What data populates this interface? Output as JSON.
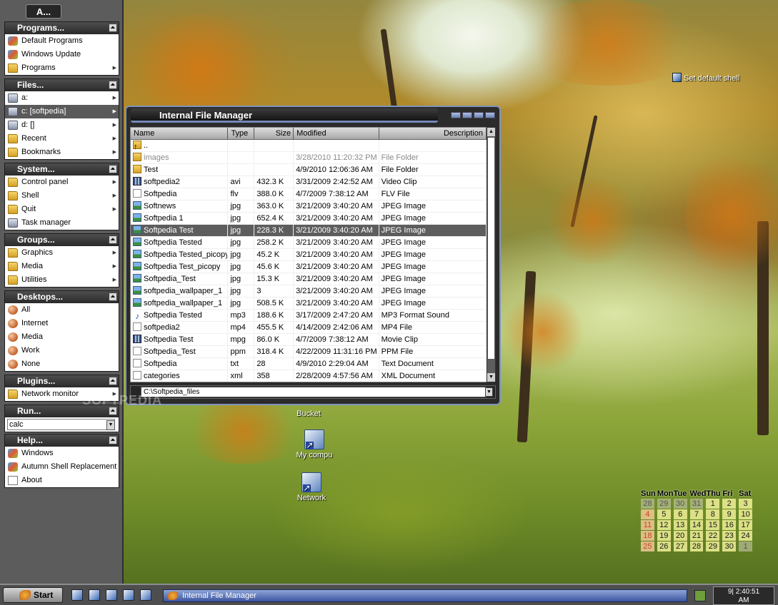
{
  "panel": {
    "title": "A...",
    "sections": [
      {
        "header": "Programs...",
        "items": [
          {
            "label": "Default Programs",
            "icon": "default-programs-icon"
          },
          {
            "label": "Windows Update",
            "icon": "windows-update-icon"
          },
          {
            "label": "Programs",
            "icon": "folder-icon",
            "submenu": true
          }
        ]
      },
      {
        "header": "Files...",
        "items": [
          {
            "label": "a:",
            "icon": "floppy-drive-icon",
            "submenu": true
          },
          {
            "label": "c: [softpedia]",
            "icon": "hard-drive-icon",
            "submenu": true,
            "selected": true
          },
          {
            "label": "d: []",
            "icon": "cd-drive-icon",
            "submenu": true
          },
          {
            "label": "Recent",
            "icon": "folder-icon",
            "submenu": true
          },
          {
            "label": "Bookmarks",
            "icon": "folder-icon",
            "submenu": true
          }
        ]
      },
      {
        "header": "System...",
        "items": [
          {
            "label": "Control panel",
            "icon": "control-panel-icon",
            "submenu": true
          },
          {
            "label": "Shell",
            "icon": "folder-icon",
            "submenu": true
          },
          {
            "label": "Quit",
            "icon": "folder-icon",
            "submenu": true
          },
          {
            "label": "Task manager",
            "icon": "task-manager-icon"
          }
        ]
      },
      {
        "header": "Groups...",
        "items": [
          {
            "label": "Graphics",
            "icon": "folder-icon",
            "submenu": true
          },
          {
            "label": "Media",
            "icon": "folder-icon",
            "submenu": true
          },
          {
            "label": "Utilities",
            "icon": "folder-icon",
            "submenu": true
          }
        ]
      },
      {
        "header": "Desktops...",
        "items": [
          {
            "label": "All",
            "icon": "desktop-globe-icon"
          },
          {
            "label": "Internet",
            "icon": "desktop-globe-icon"
          },
          {
            "label": "Media",
            "icon": "desktop-globe-icon"
          },
          {
            "label": "Work",
            "icon": "desktop-globe-icon"
          },
          {
            "label": "None",
            "icon": "desktop-globe-icon"
          }
        ]
      },
      {
        "header": "Plugins...",
        "items": [
          {
            "label": "Network monitor",
            "icon": "folder-icon",
            "submenu": true
          }
        ]
      },
      {
        "header": "Run...",
        "items": []
      },
      {
        "header": "Help...",
        "items": [
          {
            "label": "Windows",
            "icon": "windows-help-icon"
          },
          {
            "label": "Autumn Shell Replacement",
            "icon": "help-book-icon"
          },
          {
            "label": "About",
            "icon": "about-icon"
          }
        ]
      }
    ],
    "run_value": "calc"
  },
  "file_manager": {
    "title": "Internal File Manager",
    "columns": [
      "Name",
      "Type",
      "Size",
      "Modified",
      "Description"
    ],
    "rows": [
      {
        "name": "..",
        "type": "",
        "size": "",
        "modified": "",
        "description": "",
        "icon": "up-folder"
      },
      {
        "name": "images",
        "type": "",
        "size": "",
        "modified": "3/28/2010 11:20:32 PM",
        "description": "File Folder",
        "icon": "folder",
        "dim": true
      },
      {
        "name": "Test",
        "type": "",
        "size": "",
        "modified": "4/9/2010 12:06:36 AM",
        "description": "File Folder",
        "icon": "folder"
      },
      {
        "name": "softpedia2",
        "type": "avi",
        "size": "432.3 K",
        "modified": "3/31/2009 2:42:52 AM",
        "description": "Video Clip",
        "icon": "video"
      },
      {
        "name": "Softpedia",
        "type": "flv",
        "size": "388.0 K",
        "modified": "4/7/2009 7:38:12 AM",
        "description": "FLV File",
        "icon": "file"
      },
      {
        "name": "Softnews",
        "type": "jpg",
        "size": "363.0 K",
        "modified": "3/21/2009 3:40:20 AM",
        "description": "JPEG Image",
        "icon": "image"
      },
      {
        "name": "Softpedia 1",
        "type": "jpg",
        "size": "652.4 K",
        "modified": "3/21/2009 3:40:20 AM",
        "description": "JPEG Image",
        "icon": "image"
      },
      {
        "name": "Softpedia Test",
        "type": "jpg",
        "size": "228.3 K",
        "modified": "3/21/2009 3:40:20 AM",
        "description": "JPEG Image",
        "icon": "image",
        "selected": true
      },
      {
        "name": "Softpedia Tested",
        "type": "jpg",
        "size": "258.2 K",
        "modified": "3/21/2009 3:40:20 AM",
        "description": "JPEG Image",
        "icon": "image"
      },
      {
        "name": "Softpedia Tested_picopy",
        "type": "jpg",
        "size": "45.2 K",
        "modified": "3/21/2009 3:40:20 AM",
        "description": "JPEG Image",
        "icon": "image"
      },
      {
        "name": "Softpedia Test_picopy",
        "type": "jpg",
        "size": "45.6 K",
        "modified": "3/21/2009 3:40:20 AM",
        "description": "JPEG Image",
        "icon": "image"
      },
      {
        "name": "Softpedia_Test",
        "type": "jpg",
        "size": "15.3 K",
        "modified": "3/21/2009 3:40:20 AM",
        "description": "JPEG Image",
        "icon": "image"
      },
      {
        "name": "softpedia_wallpaper_1",
        "type": "jpg",
        "size": "3",
        "modified": "3/21/2009 3:40:20 AM",
        "description": "JPEG Image",
        "icon": "image"
      },
      {
        "name": "softpedia_wallpaper_1",
        "type": "jpg",
        "size": "508.5 K",
        "modified": "3/21/2009 3:40:20 AM",
        "description": "JPEG Image",
        "icon": "image"
      },
      {
        "name": "Softpedia Tested",
        "type": "mp3",
        "size": "188.6 K",
        "modified": "3/17/2009 2:47:20 AM",
        "description": "MP3 Format Sound",
        "icon": "music"
      },
      {
        "name": "softpedia2",
        "type": "mp4",
        "size": "455.5 K",
        "modified": "4/14/2009 2:42:06 AM",
        "description": "MP4 File",
        "icon": "file"
      },
      {
        "name": "Softpedia Test",
        "type": "mpg",
        "size": "86.0 K",
        "modified": "4/7/2009 7:38:12 AM",
        "description": "Movie Clip",
        "icon": "video"
      },
      {
        "name": "Softpedia_Test",
        "type": "ppm",
        "size": "318.4 K",
        "modified": "4/22/2009 11:31:16 PM",
        "description": "PPM File",
        "icon": "file"
      },
      {
        "name": "Softpedia",
        "type": "txt",
        "size": "28",
        "modified": "4/9/2010 2:29:04 AM",
        "description": "Text Document",
        "icon": "file"
      },
      {
        "name": "categories",
        "type": "xml",
        "size": "358",
        "modified": "2/28/2009 4:57:56 AM",
        "description": "XML Document",
        "icon": "file"
      }
    ],
    "path": "C:\\Softpedia_files"
  },
  "desktop_icons": [
    {
      "label": "Bucket",
      "name": "recycle-bin-shortcut"
    },
    {
      "label": "My compu",
      "name": "my-computer-shortcut"
    },
    {
      "label": "Network",
      "name": "network-shortcut"
    }
  ],
  "set_default_shell": "Set default shell",
  "calendar": {
    "days": [
      "Sun",
      "Mon",
      "Tue",
      "Wed",
      "Thu",
      "Fri",
      "Sat"
    ],
    "weeks": [
      [
        "28",
        "29",
        "30",
        "31",
        "1",
        "2",
        "3"
      ],
      [
        "4",
        "5",
        "6",
        "7",
        "8",
        "9",
        "10"
      ],
      [
        "11",
        "12",
        "13",
        "14",
        "15",
        "16",
        "17"
      ],
      [
        "18",
        "19",
        "20",
        "21",
        "22",
        "23",
        "24"
      ],
      [
        "25",
        "26",
        "27",
        "28",
        "29",
        "30",
        "1"
      ]
    ]
  },
  "taskbar": {
    "start_label": "Start",
    "task_label": "Internal File Manager",
    "clock_line1": "9| 2:40:51",
    "clock_line2": "AM"
  },
  "watermark": "SOFTPEDIA"
}
